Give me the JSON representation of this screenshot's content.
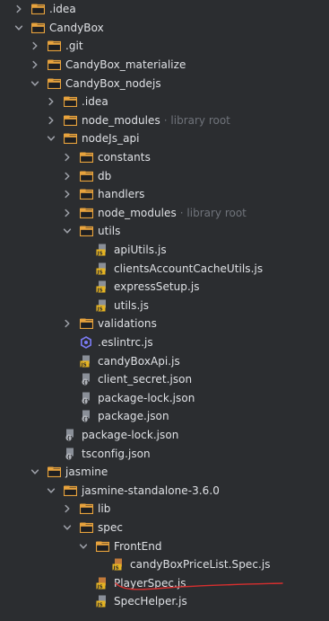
{
  "tree": [
    {
      "label": ".idea",
      "kind": "folder",
      "arrow": "right",
      "depth": 0
    },
    {
      "label": "CandyBox",
      "kind": "folder",
      "arrow": "down",
      "depth": 0
    },
    {
      "label": ".git",
      "kind": "folder",
      "arrow": "right",
      "depth": 1
    },
    {
      "label": "CandyBox_materialize",
      "kind": "folder",
      "arrow": "right",
      "depth": 1
    },
    {
      "label": "CandyBox_nodejs",
      "kind": "folder",
      "arrow": "down",
      "depth": 1
    },
    {
      "label": ".idea",
      "kind": "folder",
      "arrow": "right",
      "depth": 2
    },
    {
      "label": "node_modules",
      "hint": "library root",
      "kind": "folder",
      "arrow": "right",
      "depth": 2
    },
    {
      "label": "nodeJs_api",
      "kind": "folder",
      "arrow": "down",
      "depth": 2
    },
    {
      "label": "constants",
      "kind": "folder",
      "arrow": "right",
      "depth": 3
    },
    {
      "label": "db",
      "kind": "folder",
      "arrow": "right",
      "depth": 3
    },
    {
      "label": "handlers",
      "kind": "folder",
      "arrow": "right",
      "depth": 3
    },
    {
      "label": "node_modules",
      "hint": "library root",
      "kind": "folder",
      "arrow": "right",
      "depth": 3
    },
    {
      "label": "utils",
      "kind": "folder",
      "arrow": "down",
      "depth": 3
    },
    {
      "label": "apiUtils.js",
      "kind": "js",
      "arrow": "none",
      "depth": 4
    },
    {
      "label": "clientsAccountCacheUtils.js",
      "kind": "js",
      "arrow": "none",
      "depth": 4
    },
    {
      "label": "expressSetup.js",
      "kind": "js",
      "arrow": "none",
      "depth": 4
    },
    {
      "label": "utils.js",
      "kind": "js",
      "arrow": "none",
      "depth": 4
    },
    {
      "label": "validations",
      "kind": "folder",
      "arrow": "right",
      "depth": 3
    },
    {
      "label": ".eslintrc.js",
      "kind": "eslint",
      "arrow": "none",
      "depth": 3
    },
    {
      "label": "candyBoxApi.js",
      "kind": "js",
      "arrow": "none",
      "depth": 3
    },
    {
      "label": "client_secret.json",
      "kind": "json",
      "arrow": "none",
      "depth": 3
    },
    {
      "label": "package-lock.json",
      "kind": "json",
      "arrow": "none",
      "depth": 3
    },
    {
      "label": "package.json",
      "kind": "json",
      "arrow": "none",
      "depth": 3
    },
    {
      "label": "package-lock.json",
      "kind": "json",
      "arrow": "none",
      "depth": 2
    },
    {
      "label": "tsconfig.json",
      "kind": "json",
      "arrow": "none",
      "depth": 2
    },
    {
      "label": "jasmine",
      "kind": "folder",
      "arrow": "down",
      "depth": 1
    },
    {
      "label": "jasmine-standalone-3.6.0",
      "kind": "folder",
      "arrow": "down",
      "depth": 2
    },
    {
      "label": "lib",
      "kind": "folder",
      "arrow": "right",
      "depth": 3
    },
    {
      "label": "spec",
      "kind": "folder",
      "arrow": "down",
      "depth": 3
    },
    {
      "label": "FrontEnd",
      "kind": "folder",
      "arrow": "down",
      "depth": 4
    },
    {
      "label": "candyBoxPriceList.Spec.js",
      "kind": "jsspec",
      "arrow": "none",
      "depth": 5
    },
    {
      "label": "PlayerSpec.js",
      "kind": "jsspec",
      "arrow": "none",
      "depth": 4
    },
    {
      "label": "SpecHelper.js",
      "kind": "js",
      "arrow": "none",
      "depth": 4
    }
  ],
  "colors": {
    "background": "#2b2d30",
    "text": "#dfe1e5",
    "hint": "#6f737a",
    "folder": "#e8a33d",
    "arrow": "#9da0a8",
    "js": "#e6b422",
    "annotation": "#d62f2f"
  }
}
